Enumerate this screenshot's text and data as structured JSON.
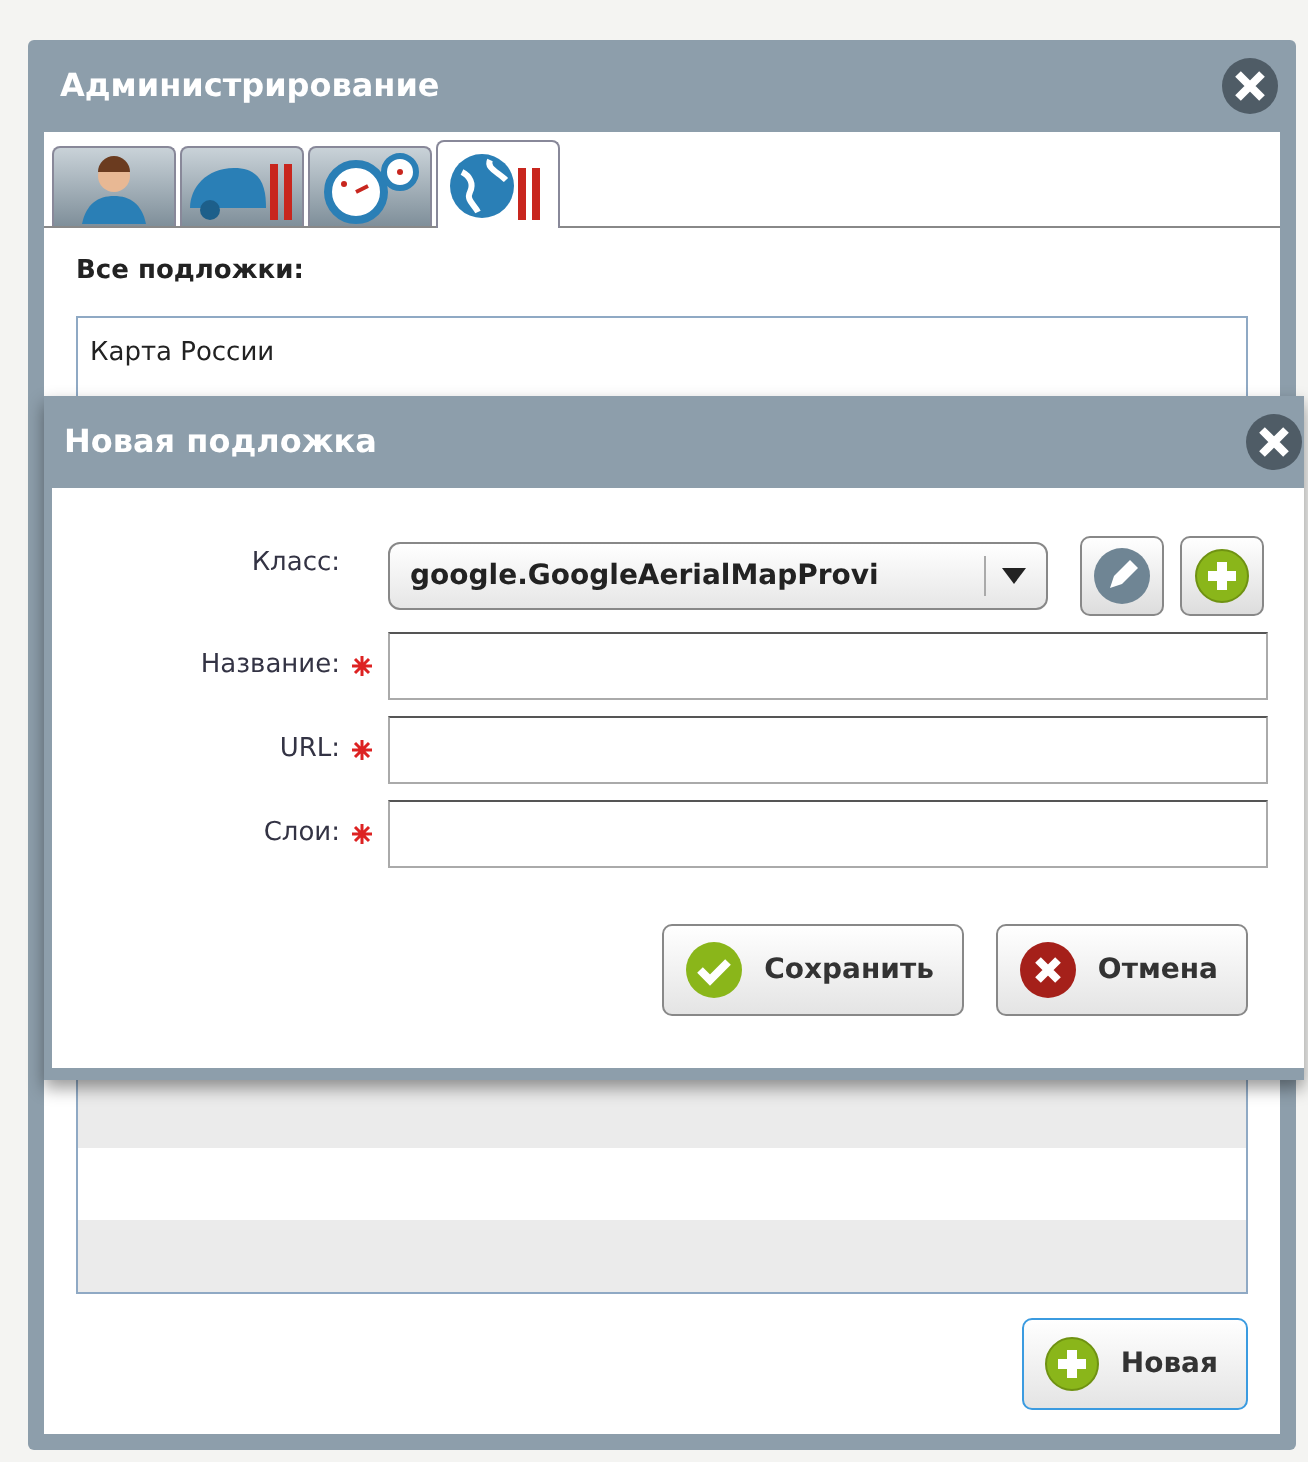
{
  "admin_window": {
    "title": "Администрирование",
    "tabs": [
      {
        "selected": false
      },
      {
        "selected": false
      },
      {
        "selected": false
      },
      {
        "selected": true
      }
    ],
    "section_label": "Все подложки:",
    "layers": [
      {
        "name": "Карта России"
      }
    ],
    "new_button": "Новая"
  },
  "dialog": {
    "title": "Новая подложка",
    "class_field": {
      "label": "Класс:",
      "value": "google.GoogleAerialMapProvi"
    },
    "fields": [
      {
        "label": "Название:",
        "required": true
      },
      {
        "label": "URL:",
        "required": true
      },
      {
        "label": "Слои:",
        "required": true
      }
    ],
    "save_button": "Сохранить",
    "cancel_button": "Отмена"
  }
}
